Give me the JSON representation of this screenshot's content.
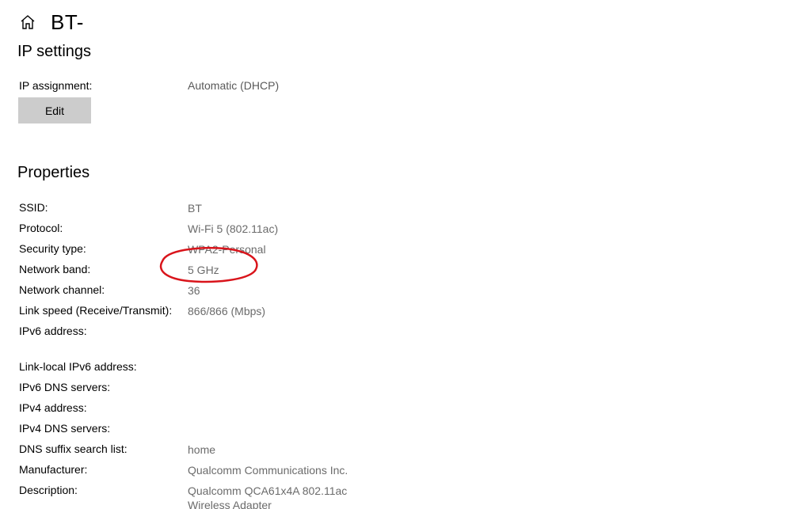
{
  "header": {
    "title": "BT-",
    "icon": "home-icon"
  },
  "ip_settings": {
    "title": "IP settings",
    "assignment_label": "IP assignment:",
    "assignment_value": "Automatic (DHCP)",
    "edit_label": "Edit"
  },
  "properties": {
    "title": "Properties",
    "rows": [
      {
        "label": "SSID:",
        "value": "BT"
      },
      {
        "label": "Protocol:",
        "value": "Wi-Fi 5 (802.11ac)"
      },
      {
        "label": "Security type:",
        "value": "WPA2-Personal"
      },
      {
        "label": "Network band:",
        "value": "5 GHz"
      },
      {
        "label": "Network channel:",
        "value": "36"
      },
      {
        "label": "Link speed (Receive/Transmit):",
        "value": "866/866 (Mbps)"
      },
      {
        "label": "IPv6 address:",
        "value": ""
      },
      {
        "label": "Link-local IPv6 address:",
        "value": ""
      },
      {
        "label": "IPv6 DNS servers:",
        "value": ""
      },
      {
        "label": "IPv4 address:",
        "value": ""
      },
      {
        "label": "IPv4 DNS servers:",
        "value": ""
      },
      {
        "label": "DNS suffix search list:",
        "value": "home"
      },
      {
        "label": "Manufacturer:",
        "value": "Qualcomm Communications Inc."
      },
      {
        "label": "Description:",
        "value": "Qualcomm QCA61x4A 802.11ac Wireless Adapter"
      }
    ]
  },
  "annotation_color": "#d9141b"
}
